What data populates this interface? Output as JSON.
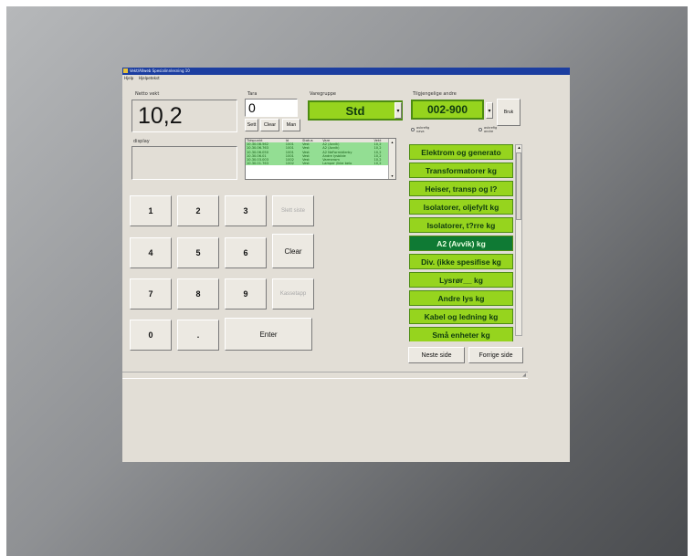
{
  "window": {
    "title": "Vekt/Allweb Spesialinnlesning 10"
  },
  "menu": [
    "Hjelp",
    "Hjelpetekst"
  ],
  "netto": {
    "label": "Netto vekt",
    "value": "10,2"
  },
  "tara": {
    "label": "Tara",
    "value": "0",
    "buttons": [
      "Sett",
      "Clear",
      "Man"
    ]
  },
  "varegruppe": {
    "label": "Varegruppe",
    "value": "Std"
  },
  "display": {
    "label": "display",
    "value": ""
  },
  "log": {
    "headers": [
      "Tidspunkt",
      "Id",
      "Status",
      "Vare",
      "Vekt"
    ],
    "rows": [
      [
        "10.30.08.562",
        "1001",
        "Vest",
        "A2 (Avvik)",
        "10,2"
      ],
      [
        "10.30.06.763",
        "1001",
        "Vest",
        "A2 (Avvik)",
        "10,2"
      ],
      [
        "10.30.06.050",
        "1001",
        "Vest",
        "A2 NeFormidlerby",
        "10,2"
      ],
      [
        "10.30.06.01",
        "1001",
        "Vest",
        "Andre lysbilde",
        "10,2"
      ],
      [
        "10.30.03.003",
        "1002",
        "Vest",
        "Varmerom",
        "10,2"
      ],
      [
        "10.30.01.763",
        "1002",
        "Vest",
        "Lamper /ikke belo",
        "10,2"
      ]
    ]
  },
  "keypad": {
    "digits": [
      "1",
      "2",
      "3",
      "4",
      "5",
      "6",
      "7",
      "8",
      "9",
      "0",
      "."
    ],
    "slett_siste": "Slett siste",
    "clear": "Clear",
    "kassetapp": "Kassetapp",
    "enter": "Enter"
  },
  "tilgjengelige": {
    "label": "Tilgjengelige andre",
    "code": "002-900",
    "brak": "Bruk",
    "opt1": "avkrefig\nnava",
    "opt2": "avkrefig\nandre"
  },
  "categories": [
    {
      "label": "Elektrom og generato",
      "selected": false
    },
    {
      "label": "Transformatorer kg",
      "selected": false
    },
    {
      "label": "Heiser, transp og l?",
      "selected": false
    },
    {
      "label": "Isolatorer, oljefylt kg",
      "selected": false
    },
    {
      "label": "Isolatorer, t?rre kg",
      "selected": false
    },
    {
      "label": "A2 (Avvik) kg",
      "selected": true
    },
    {
      "label": "Div. (ikke spesifise kg",
      "selected": false
    },
    {
      "label": "Lysrør__ kg",
      "selected": false
    },
    {
      "label": "Andre lys kg",
      "selected": false
    },
    {
      "label": "Kabel og ledning kg",
      "selected": false
    },
    {
      "label": "Små enheter kg",
      "selected": false
    }
  ],
  "paging": {
    "next": "Neste side",
    "prev": "Forrige side"
  },
  "colors": {
    "accent_green": "#96d41e",
    "selected_green": "#0f7a34",
    "log_green": "#93de93",
    "title_blue": "#1c3ea0"
  }
}
